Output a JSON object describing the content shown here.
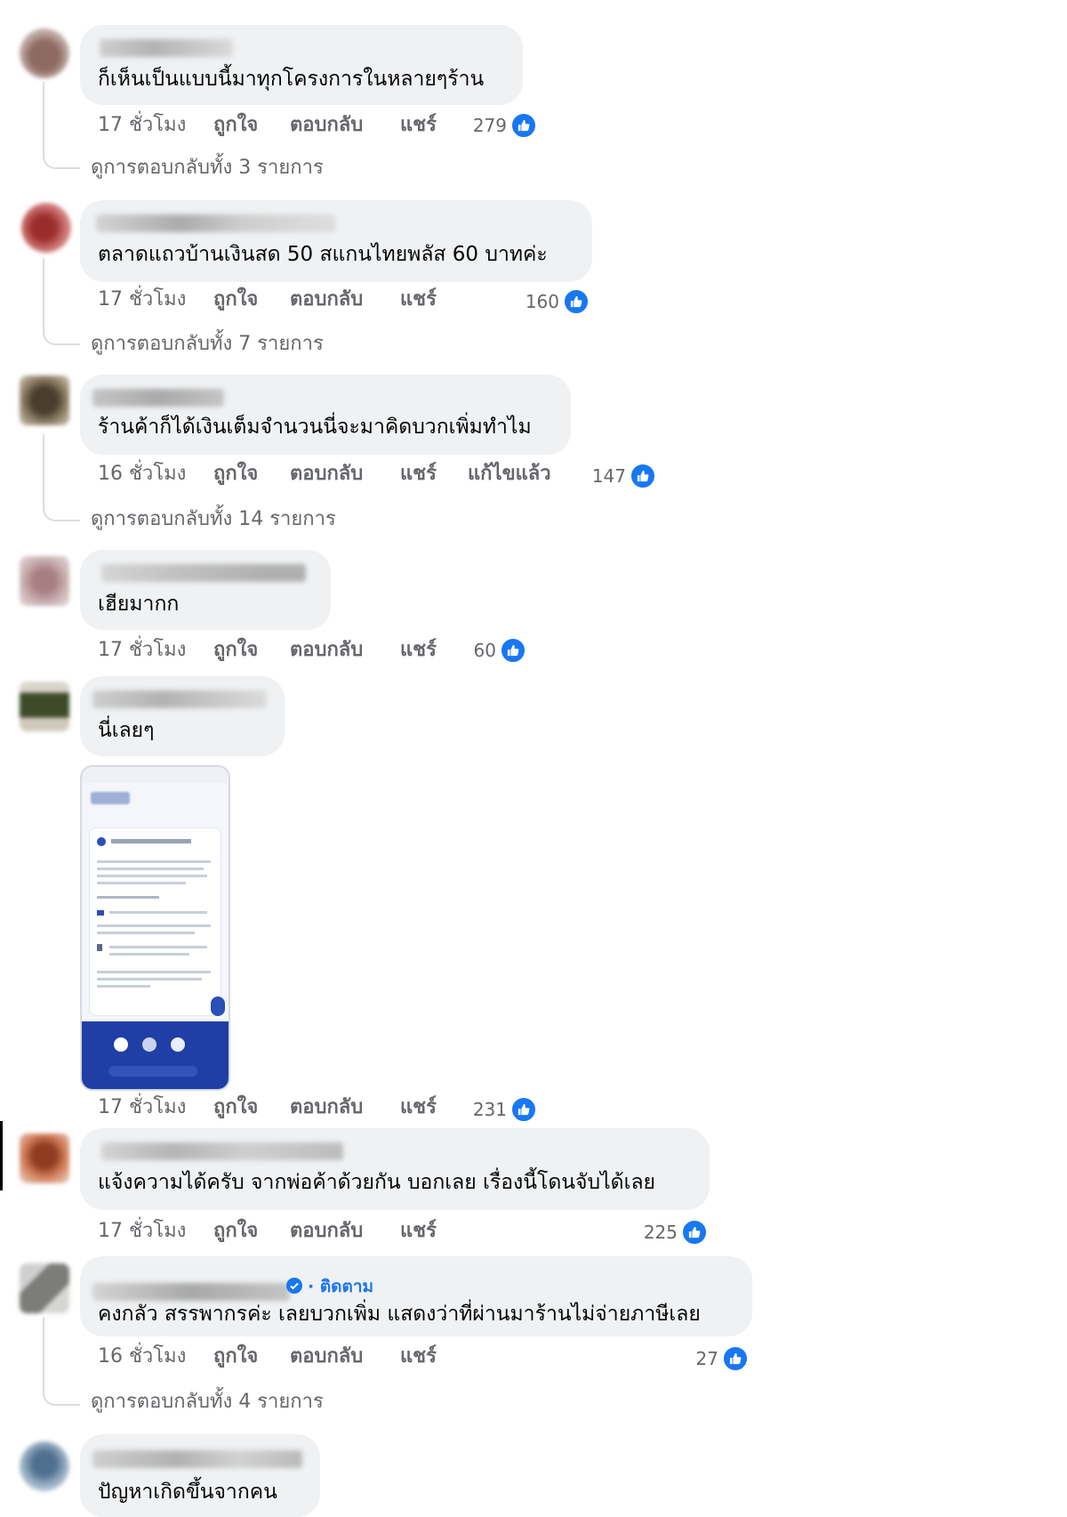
{
  "comments": [
    {
      "text": "ก็เห็นเป็นแบบนี้มาทุกโครงการในหลายๆร้าน",
      "time": "17 ชั่วโมง",
      "like": "ถูกใจ",
      "reply": "ตอบกลับ",
      "share": "แชร์",
      "reactions": "279",
      "view_replies": "ดูการตอบกลับทั้ง 3 รายการ"
    },
    {
      "text": "ตลาดแถวบ้านเงินสด 50 สแกนไทยพลัส 60 บาทค่ะ",
      "time": "17 ชั่วโมง",
      "like": "ถูกใจ",
      "reply": "ตอบกลับ",
      "share": "แชร์",
      "reactions": "160",
      "view_replies": "ดูการตอบกลับทั้ง 7 รายการ"
    },
    {
      "text": "ร้านค้าก็ได้เงินเต็มจำนวนนี่จะมาคิดบวกเพิ่มทำไม",
      "time": "16 ชั่วโมง",
      "like": "ถูกใจ",
      "reply": "ตอบกลับ",
      "share": "แชร์",
      "edited": "แก้ไขแล้ว",
      "reactions": "147",
      "view_replies": "ดูการตอบกลับทั้ง 14 รายการ"
    },
    {
      "text": "เฮียมากก",
      "time": "17 ชั่วโมง",
      "like": "ถูกใจ",
      "reply": "ตอบกลับ",
      "share": "แชร์",
      "reactions": "60"
    },
    {
      "text": "นี่เลยๆ",
      "time": "17 ชั่วโมง",
      "like": "ถูกใจ",
      "reply": "ตอบกลับ",
      "share": "แชร์",
      "reactions": "231"
    },
    {
      "text": "แจ้งความได้ครับ จากพ่อค้าด้วยกัน บอกเลย เรื่องนี้โดนจับได้เลย",
      "time": "17 ชั่วโมง",
      "like": "ถูกใจ",
      "reply": "ตอบกลับ",
      "share": "แชร์",
      "reactions": "225"
    },
    {
      "follow": "· ติดตาม",
      "text": "คงกลัว สรรพากรค่ะ เลยบวกเพิ่ม แสดงว่าที่ผ่านมาร้านไม่จ่ายภาษีเลย",
      "time": "16 ชั่วโมง",
      "like": "ถูกใจ",
      "reply": "ตอบกลับ",
      "share": "แชร์",
      "reactions": "27",
      "view_replies": "ดูการตอบกลับทั้ง 4 รายการ"
    },
    {
      "text": "ปัญหาเกิดขึ้นจากคน"
    }
  ],
  "colors": {
    "bubble": "#eff1f3",
    "meta_text": "#65676b",
    "like_blue": "#1877f2"
  }
}
